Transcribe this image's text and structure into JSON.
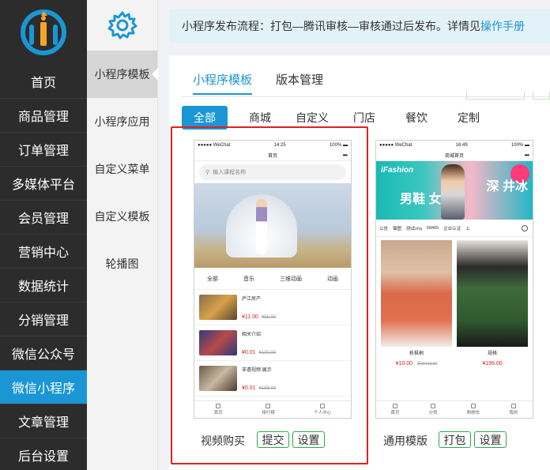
{
  "nav": {
    "items": [
      {
        "label": "首页"
      },
      {
        "label": "商品管理"
      },
      {
        "label": "订单管理"
      },
      {
        "label": "多媒体平台"
      },
      {
        "label": "会员管理"
      },
      {
        "label": "营销中心"
      },
      {
        "label": "数据统计"
      },
      {
        "label": "分销管理"
      },
      {
        "label": "微信公众号"
      },
      {
        "label": "微信小程序"
      },
      {
        "label": "文章管理"
      },
      {
        "label": "后台设置"
      }
    ],
    "active_index": 9,
    "accent": "#1b96d4"
  },
  "subnav": {
    "items": [
      {
        "label": "小程序模板"
      },
      {
        "label": "小程序应用"
      },
      {
        "label": "自定义菜单"
      },
      {
        "label": "自定义模板"
      },
      {
        "label": "轮播图"
      }
    ],
    "active_index": 0,
    "icon": "gear-icon"
  },
  "notice": {
    "text": "小程序发布流程：打包—腾讯审核—审核通过后发布。详情见",
    "link": "操作手册"
  },
  "tabs": [
    {
      "label": "小程序模板"
    },
    {
      "label": "版本管理"
    }
  ],
  "filters": [
    {
      "label": "全部"
    },
    {
      "label": "商城"
    },
    {
      "label": "自定义"
    },
    {
      "label": "门店"
    },
    {
      "label": "餐饮"
    },
    {
      "label": "定制"
    }
  ],
  "templates": [
    {
      "name": "视频购买",
      "buttons": [
        "提交",
        "设置"
      ],
      "phone": {
        "carrier": "●●●●● WeChat",
        "time": "14:25",
        "battery": "100%",
        "title": "首页",
        "search_placeholder": "输入课程名称",
        "categories": [
          "全部",
          "音乐",
          "三维动画",
          "动画"
        ],
        "list": [
          {
            "title": "庐江房产",
            "price": "¥11.00",
            "old_price": "¥55.00"
          },
          {
            "title": "相关介绍",
            "price": "¥0.01",
            "old_price": "¥100.00"
          },
          {
            "title": "非遗视频 展示",
            "price": "¥0.01",
            "old_price": "¥188.00"
          }
        ],
        "tabbar": [
          "首页",
          "排行榜",
          "个人中心"
        ]
      }
    },
    {
      "name": "通用模版",
      "buttons": [
        "打包",
        "设置"
      ],
      "phone": {
        "carrier": "●●●●● WeChat",
        "time": "16:49",
        "battery": "100%",
        "title": "商城首页",
        "banner": {
          "brand": "iFashion",
          "text_left": "男鞋 女鞋",
          "text_right": "深 井冰"
        },
        "categories": [
          "公告",
          "锄图",
          "测试xhq",
          "68465",
          "企业认证",
          "上"
        ],
        "products": [
          {
            "name": "栋枫桐",
            "price": "¥10.00",
            "old_price": "原价¥10.00"
          },
          {
            "name": "规格",
            "price": "¥199.00"
          }
        ],
        "tabbar": [
          "首页",
          "分类",
          "购物车",
          "我的"
        ]
      }
    }
  ]
}
